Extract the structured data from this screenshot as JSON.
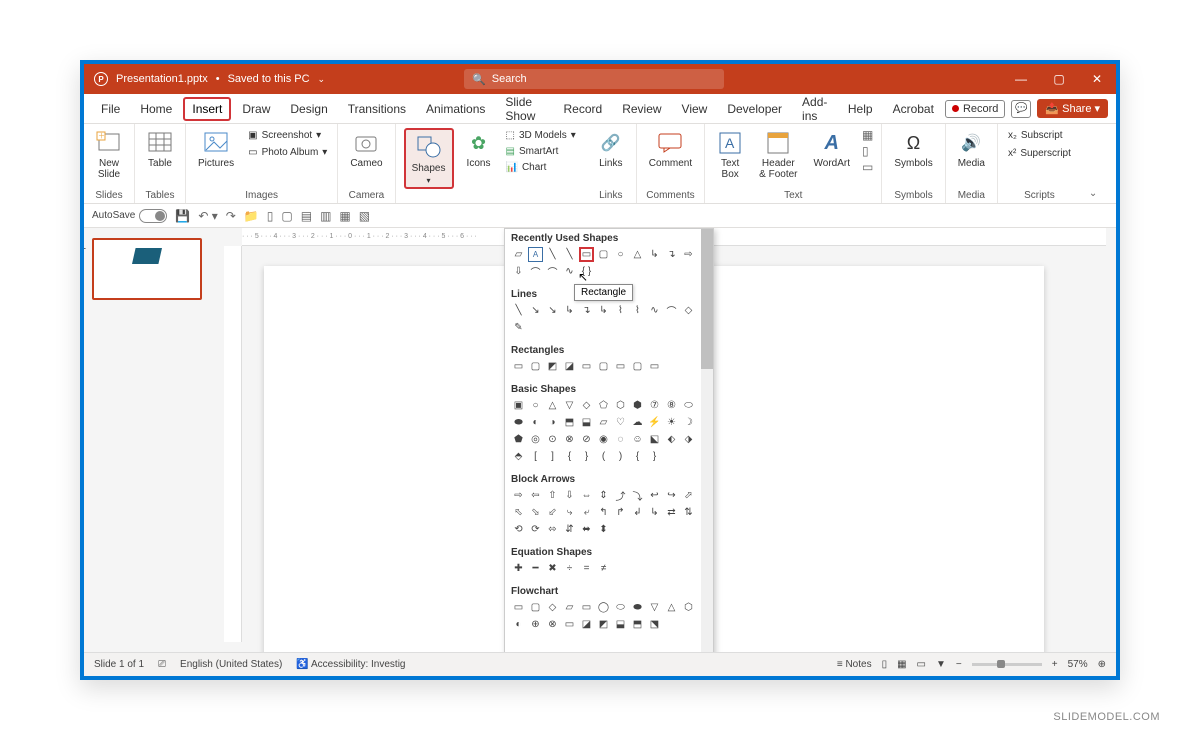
{
  "title": {
    "filename": "Presentation1.pptx",
    "saved": "Saved to this PC"
  },
  "search": {
    "placeholder": "Search"
  },
  "tabs": [
    "File",
    "Home",
    "Insert",
    "Draw",
    "Design",
    "Transitions",
    "Animations",
    "Slide Show",
    "Record",
    "Review",
    "View",
    "Developer",
    "Add-ins",
    "Help",
    "Acrobat"
  ],
  "tab_actions": {
    "record": "Record",
    "share": "Share"
  },
  "ribbon": {
    "slides": {
      "label": "Slides",
      "new_slide": "New\nSlide"
    },
    "tables": {
      "label": "Tables",
      "table": "Table"
    },
    "images": {
      "label": "Images",
      "pictures": "Pictures",
      "screenshot": "Screenshot",
      "photo_album": "Photo Album"
    },
    "camera": {
      "label": "Camera",
      "cameo": "Cameo"
    },
    "illustrations": {
      "shapes": "Shapes",
      "icons": "Icons",
      "models": "3D Models",
      "smartart": "SmartArt",
      "chart": "Chart"
    },
    "links": {
      "label": "Links",
      "links": "Links"
    },
    "comments": {
      "label": "Comments",
      "comment": "Comment"
    },
    "text": {
      "label": "Text",
      "textbox": "Text\nBox",
      "header": "Header\n& Footer",
      "wordart": "WordArt"
    },
    "symbols": {
      "label": "Symbols",
      "symbols": "Symbols"
    },
    "media": {
      "label": "Media",
      "media": "Media"
    },
    "scripts": {
      "label": "Scripts",
      "subscript": "Subscript",
      "superscript": "Superscript"
    }
  },
  "qat": {
    "autosave": "AutoSave"
  },
  "shapes_panel": {
    "recently": "Recently Used Shapes",
    "lines": "Lines",
    "rectangles": "Rectangles",
    "basic": "Basic Shapes",
    "block": "Block Arrows",
    "equation": "Equation Shapes",
    "flowchart": "Flowchart",
    "tooltip": "Rectangle"
  },
  "statusbar": {
    "slide": "Slide 1 of 1",
    "lang": "English (United States)",
    "access": "Accessibility: Investig",
    "notes": "Notes",
    "zoom": "57%"
  },
  "thumbnail": {
    "number": "1"
  },
  "watermark": "SLIDEMODEL.COM"
}
